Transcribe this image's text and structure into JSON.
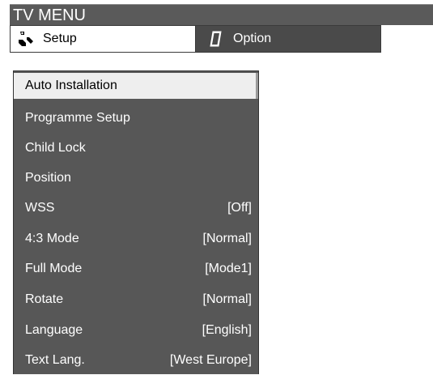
{
  "window": {
    "title": "TV MENU"
  },
  "tabs": [
    {
      "label": "Setup",
      "icon": "wrench-icon",
      "active": true
    },
    {
      "label": "Option",
      "icon": "note-icon",
      "active": false
    }
  ],
  "menu": {
    "items": [
      {
        "label": "Auto Installation",
        "value": "",
        "selected": true
      },
      {
        "label": "Programme Setup",
        "value": ""
      },
      {
        "label": "Child Lock",
        "value": ""
      },
      {
        "label": "Position",
        "value": ""
      },
      {
        "label": "WSS",
        "value": "[Off]"
      },
      {
        "label": "4:3 Mode",
        "value": "[Normal]"
      },
      {
        "label": "Full Mode",
        "value": "[Mode1]"
      },
      {
        "label": "Rotate",
        "value": "[Normal]"
      },
      {
        "label": "Language",
        "value": "[English]"
      },
      {
        "label": "Text Lang.",
        "value": "[West Europe]"
      }
    ]
  },
  "colors": {
    "title_bar": "#5a5a5a",
    "menu_bg": "#575757",
    "selected_bg": "#eeeeee"
  }
}
